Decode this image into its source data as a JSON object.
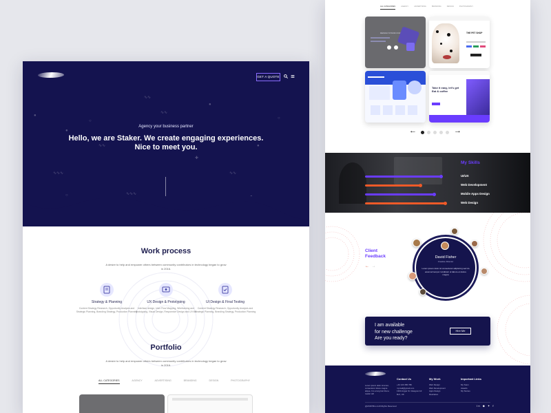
{
  "colors": {
    "navy": "#14134f",
    "accent_purple": "#6a3cff",
    "bar_purple": "#6a3cff",
    "bar_orange": "#f05a28",
    "canvas_bg": "#e6e7ec"
  },
  "left": {
    "header": {
      "quote_button": "GET A QUOTE",
      "search_icon": "search-icon",
      "menu_icon": "menu-icon"
    },
    "hero": {
      "kicker": "Agency your business partner",
      "title": "Hello, we are Staker. We create engaging experiences. Nice to meet you."
    },
    "work_process": {
      "title": "Work process",
      "subtitle": "A desire to help and empower others between community contributors in technology began to grow in 2016.",
      "steps": [
        {
          "icon": "strategy-icon",
          "title": "Strategy & Planning",
          "desc": "Content Strategy Research, Opportunity Analysis and Strategic Planning, Branding Strategy, Production Planning"
        },
        {
          "icon": "design-icon",
          "title": "UX Design & Prototyping",
          "desc": "Interface design, User Flow Mapping, Wireframing and Prototyping, Visual Design, Responsive Design and UI Kits"
        },
        {
          "icon": "testing-icon",
          "title": "UI Design & Final Testing",
          "desc": "Content Strategy Research, Opportunity Analysis and Strategic Planning, Branding Strategy, Production Planning"
        }
      ]
    },
    "portfolio": {
      "title": "Portfolio",
      "subtitle": "A desire to help and empower others between community contributors in technology began to grow in 2016.",
      "tabs": [
        "ALL CATEGORIES",
        "AGENCY",
        "ADVERTISING",
        "BRANDING",
        "DESIGN",
        "PHOTOGRAPHY"
      ]
    }
  },
  "right": {
    "portfolio_tabs": [
      "ALL CATEGORIES",
      "AGENCY",
      "ADVERTISING",
      "BRANDING",
      "DESIGN",
      "PHOTOGRAPHY"
    ],
    "cards": [
      {
        "heading": "DESIGN STUDIO INC"
      },
      {
        "heading": "THE PET SHOP"
      },
      {
        "heading": ""
      },
      {
        "heading": "Take it easy, let's get Eat & coffee"
      }
    ],
    "carousel": {
      "prev": "←",
      "next": "→",
      "dots": 5,
      "active": 0
    },
    "skills": {
      "title": "My Skills",
      "items": [
        {
          "label": "UI/UX",
          "level": 0.85,
          "color": "#6a3cff"
        },
        {
          "label": "Web Development",
          "level": 0.62,
          "color": "#f05a28"
        },
        {
          "label": "Mobile Apps Design",
          "level": 0.78,
          "color": "#6a3cff"
        },
        {
          "label": "Web Design",
          "level": 0.9,
          "color": "#f05a28"
        }
      ]
    },
    "feedback": {
      "title_line1": "Client",
      "title_line2": "Feedback",
      "prev": "←",
      "next": "→",
      "name": "David Fisher",
      "role": "Creative Director",
      "quote": "Lorem ipsum dolor sit consectetur adipiscing sed do eiusmod tempor incididunt ut labore et dolore magna"
    },
    "cta": {
      "line1": "I am available",
      "line2": "for new challenge",
      "line3": "Are you ready?",
      "button": "Hire Me"
    },
    "footer": {
      "about": "Lorem ipsum dolor sit amet, consectetur dolore magna aliqua. It is a long fact that a reader will",
      "columns": [
        {
          "title": "Contact Us",
          "items": [
            "+44 123 456 789",
            "mymail@gmail.com",
            "1304 Argyle St. Glasgow G3 8LX, UK"
          ]
        },
        {
          "title": "My Work",
          "items": [
            "Web Design",
            "Web Development",
            "Apps Design",
            "Illustration"
          ]
        },
        {
          "title": "Important Links",
          "items": [
            "My Team",
            "Awards",
            "My Stories"
          ]
        }
      ],
      "copyright": "@2018 BILLA All Rights Reserved",
      "social": "in ◆ ✦ f"
    }
  }
}
